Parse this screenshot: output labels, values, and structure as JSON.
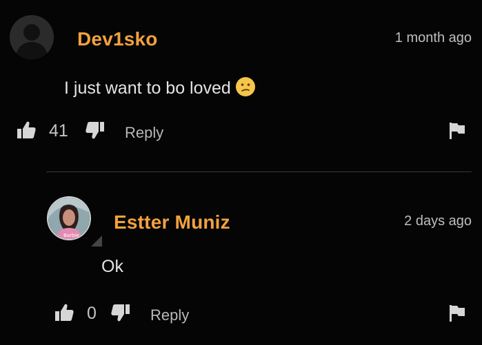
{
  "colors": {
    "background": "#050505",
    "username": "#f2a13f",
    "text": "#e4e4e4",
    "muted": "#bfbfbf",
    "icon": "#d6d6d6",
    "divider": "#3a3a3a"
  },
  "comments": [
    {
      "username": "Dev1sko",
      "timestamp": "1 month ago",
      "text": "I just want to bo loved",
      "emoji": "confused-face",
      "likes": "41",
      "reply_label": "Reply",
      "avatar": "default-user-silhouette"
    },
    {
      "username": "Estter Muniz",
      "timestamp": "2 days ago",
      "text": "Ok",
      "likes": "0",
      "reply_label": "Reply",
      "avatar": "profile-photo"
    }
  ]
}
